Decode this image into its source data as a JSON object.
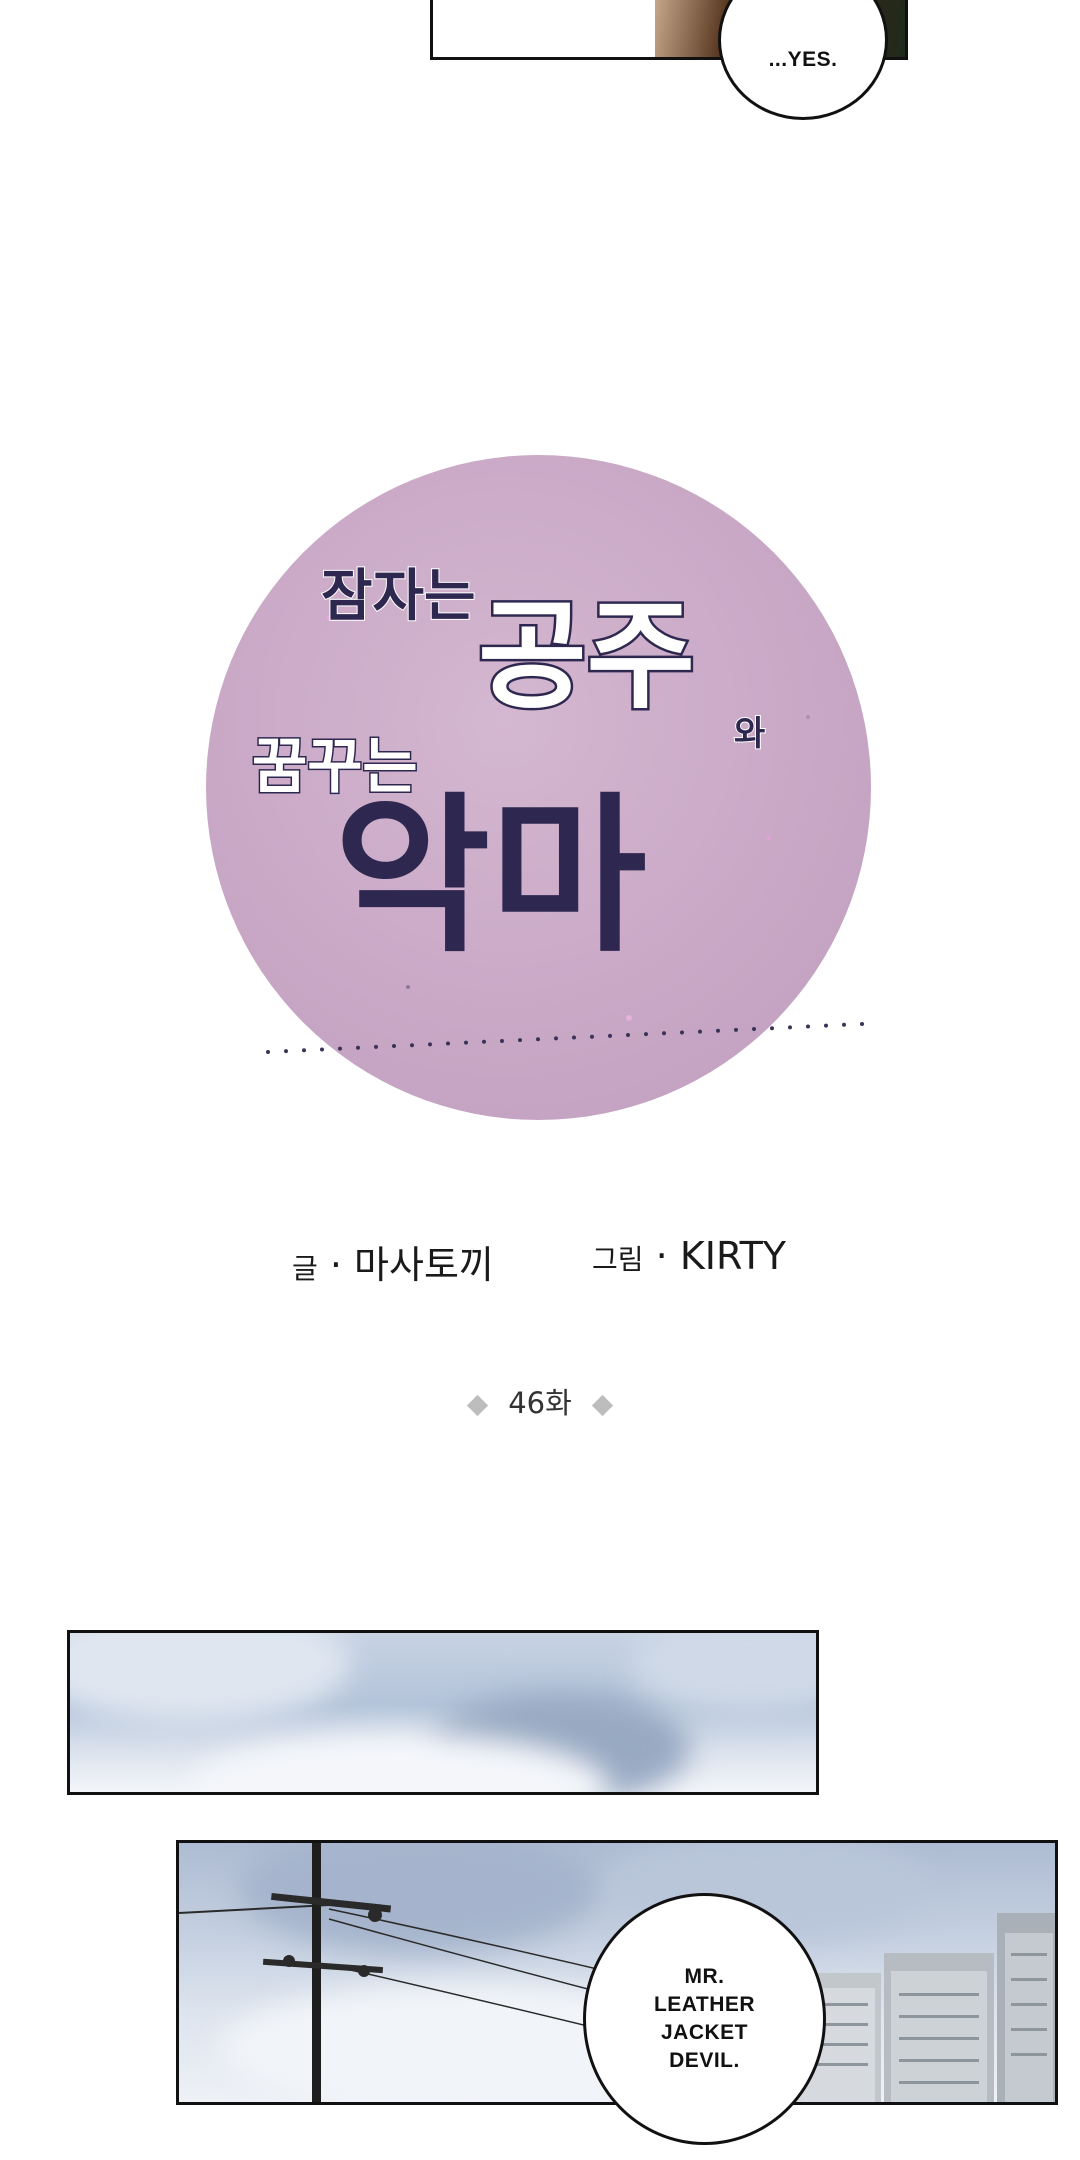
{
  "top_panel": {
    "bubble_text": "...YES."
  },
  "logo": {
    "line1_small": "잠자는",
    "line1_big": "공주",
    "line1_suffix": "와",
    "line2_small": "꿈꾸는",
    "line3_big": "악마",
    "circle_color": "#c9a8c6",
    "text_color": "#2e2850"
  },
  "credits": {
    "writer_label": "글",
    "writer_name": "마사토끼",
    "artist_label": "그림",
    "artist_name": "KIRTY",
    "separator": "·"
  },
  "episode": {
    "label": "46화"
  },
  "panel_bottom": {
    "bubble_lines": [
      "MR.",
      "LEATHER",
      "JACKET",
      "DEVIL."
    ]
  }
}
